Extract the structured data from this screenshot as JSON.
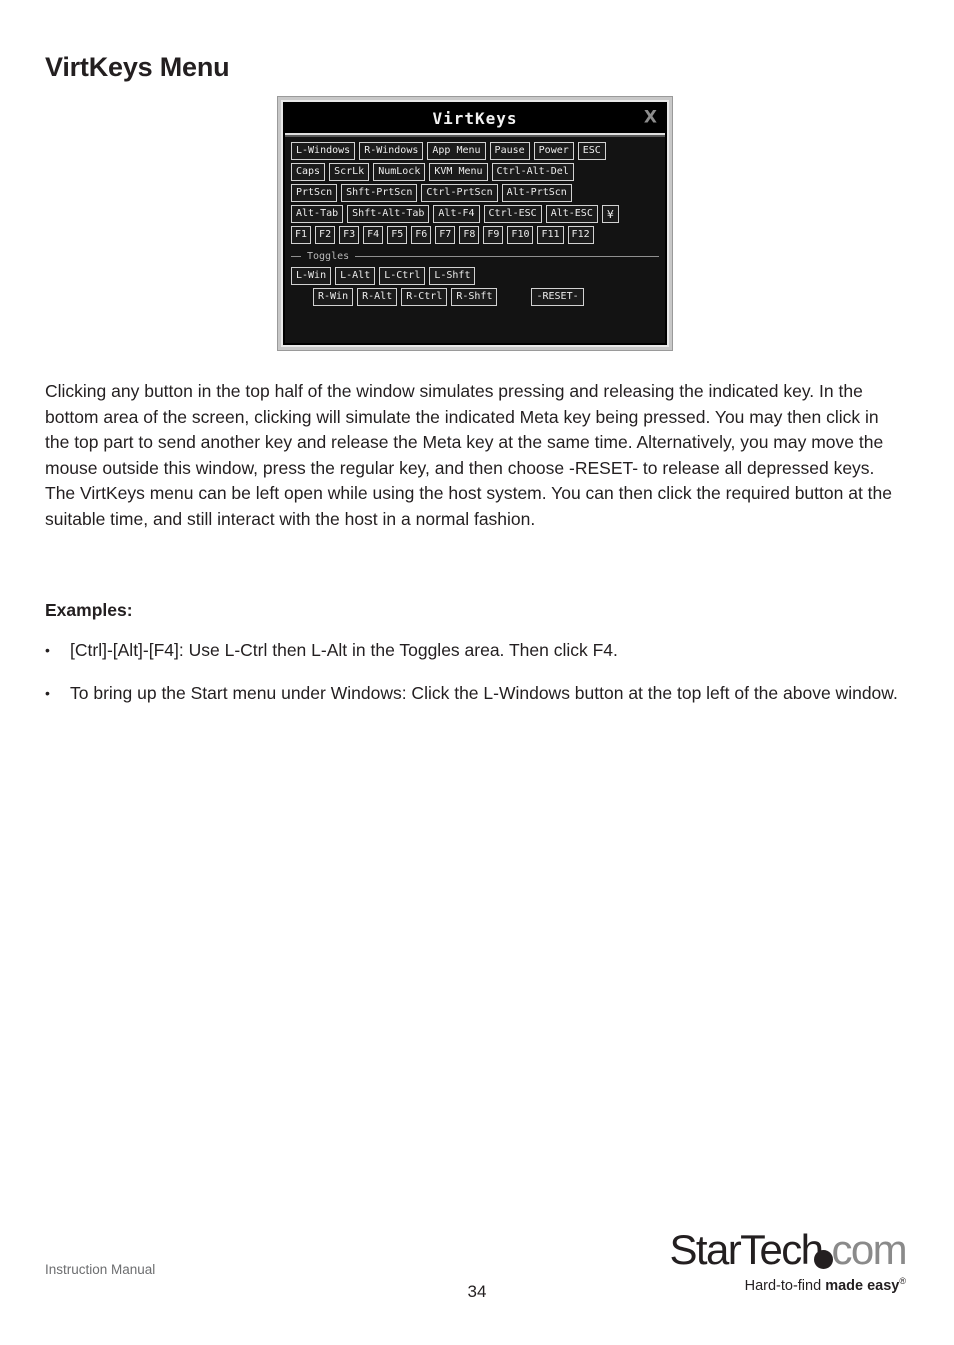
{
  "page": {
    "title": "VirtKeys Menu",
    "body_paragraph": "Clicking any button in the top half of the window simulates pressing and releasing the indicated key. In the bottom area of the screen, clicking will simulate the indicated Meta key being pressed. You may then click in the top part to send another key and release the Meta key at the same time. Alternatively, you may move the mouse outside this window, press the regular key, and then choose -RESET- to release all depressed keys. The VirtKeys menu can be left open while using the host system. You can then click the required button at the suitable time, and still interact with the host in a normal fashion.",
    "examples_heading": "Examples:",
    "bullets": [
      {
        "marker": "•",
        "text": "[Ctrl]-[Alt]-[F4]: Use L-Ctrl then L-Alt in the Toggles area. Then click F4."
      },
      {
        "marker": "•",
        "text": "To bring up the Start menu under Windows: Click the L-Windows button at the top left of the above window."
      }
    ]
  },
  "dialog": {
    "title": "VirtKeys",
    "close_label": "X",
    "toggles_legend": "Toggles",
    "rows": [
      [
        "L-Windows",
        "R-Windows",
        "App Menu",
        "Pause",
        "Power",
        "ESC"
      ],
      [
        "Caps",
        "ScrLk",
        "NumLock",
        "KVM Menu",
        "Ctrl-Alt-Del"
      ],
      [
        "PrtScn",
        "Shft-PrtScn",
        "Ctrl-PrtScn",
        "Alt-PrtScn"
      ],
      [
        "Alt-Tab",
        "Shft-Alt-Tab",
        "Alt-F4",
        "Ctrl-ESC",
        "Alt-ESC",
        "¥"
      ],
      [
        "F1",
        "F2",
        "F3",
        "F4",
        "F5",
        "F6",
        "F7",
        "F8",
        "F9",
        "F10",
        "F11",
        "F12"
      ]
    ],
    "toggle_rows": [
      [
        "L-Win",
        "L-Alt",
        "L-Ctrl",
        "L-Shft"
      ],
      [
        "R-Win",
        "R-Alt",
        "R-Ctrl",
        "R-Shft",
        "-RESET-"
      ]
    ]
  },
  "footer": {
    "left": "Instruction Manual",
    "page_number": "34",
    "logo_name": "StarTech",
    "logo_suffix": "com",
    "tagline_plain": "Hard-to-find ",
    "tagline_bold": "made easy",
    "tagline_mark": "®"
  },
  "colors": {
    "text": "#231f20",
    "muted": "#6d6e70",
    "dialog_bg": "#131313",
    "key_border": "#d2d2d2"
  }
}
